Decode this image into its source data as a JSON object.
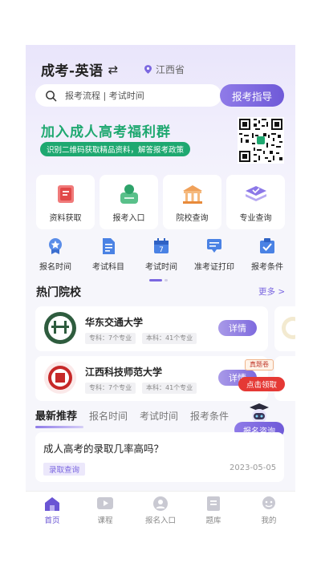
{
  "header": {
    "title": "成考-英语",
    "swap_icon": "swap-arrows-icon",
    "location": "江西省"
  },
  "search": {
    "placeholder": "报考流程 | 考试时间",
    "guide_button": "报考指导"
  },
  "banner": {
    "title": "加入成人高考福利群",
    "subtitle": "识别二维码获取精品资料，解答报考政策"
  },
  "categories": [
    {
      "label": "资料获取",
      "icon": "book-icon"
    },
    {
      "label": "报考入口",
      "icon": "apply-entry-icon"
    },
    {
      "label": "院校查询",
      "icon": "building-icon"
    },
    {
      "label": "专业查询",
      "icon": "layers-icon"
    }
  ],
  "quick_links": [
    {
      "label": "报名时间",
      "icon": "badge-star-icon"
    },
    {
      "label": "考试科目",
      "icon": "document-icon"
    },
    {
      "label": "考试时间",
      "icon": "calendar-icon"
    },
    {
      "label": "准考证打印",
      "icon": "print-icon"
    },
    {
      "label": "报考条件",
      "icon": "checklist-icon"
    }
  ],
  "hot_schools": {
    "title": "热门院校",
    "more": "更多 >",
    "items": [
      {
        "name": "华东交通大学",
        "tag1": "专科：7个专业",
        "tag2": "本科：41个专业",
        "button": "详情"
      },
      {
        "name": "江西科技师范大学",
        "tag1": "专科：7个专业",
        "tag2": "本科：41个专业",
        "button": "详情"
      }
    ]
  },
  "float_gift": {
    "top": "真题卷",
    "button": "点击领取"
  },
  "tabs": {
    "items": [
      "最新推荐",
      "报名时间",
      "考试时间",
      "报考条件"
    ],
    "active": 0
  },
  "consult": {
    "button": "报名咨询"
  },
  "article": {
    "title": "成人高考的录取几率高吗？",
    "tag": "录取查询",
    "date": "2023-05-05"
  },
  "tabbar": [
    {
      "label": "首页",
      "icon": "home-icon",
      "active": true
    },
    {
      "label": "课程",
      "icon": "play-course-icon",
      "active": false
    },
    {
      "label": "报名入口",
      "icon": "user-entry-icon",
      "active": false
    },
    {
      "label": "题库",
      "icon": "question-bank-icon",
      "active": false
    },
    {
      "label": "我的",
      "icon": "profile-icon",
      "active": false
    }
  ],
  "colors": {
    "accent": "#7b67e0",
    "banner_green": "#1ea870",
    "gift_red": "#e53935"
  }
}
